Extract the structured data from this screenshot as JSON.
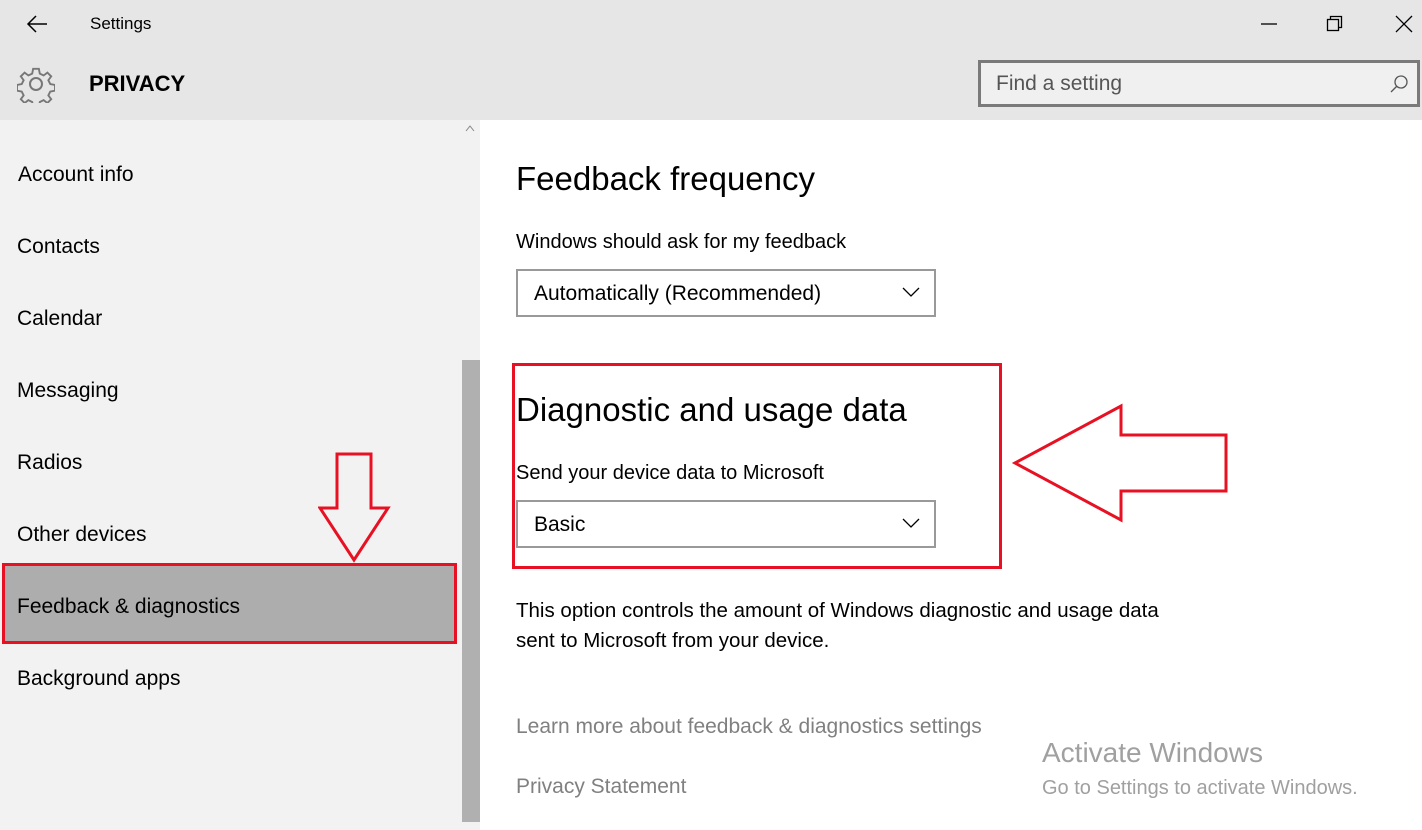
{
  "window": {
    "title": "Settings",
    "minimize": "minimize",
    "restore": "restore",
    "close": "close"
  },
  "header": {
    "section": "PRIVACY",
    "search_placeholder": "Find a setting"
  },
  "sidebar": {
    "items": [
      {
        "label": "Account info"
      },
      {
        "label": "Contacts"
      },
      {
        "label": "Calendar"
      },
      {
        "label": "Messaging"
      },
      {
        "label": "Radios"
      },
      {
        "label": "Other devices"
      },
      {
        "label": "Feedback & diagnostics",
        "selected": true
      },
      {
        "label": "Background apps"
      }
    ]
  },
  "main": {
    "feedback": {
      "heading": "Feedback frequency",
      "label": "Windows should ask for my feedback",
      "value": "Automatically (Recommended)"
    },
    "diagnostic": {
      "heading": "Diagnostic and usage data",
      "label": "Send your device data to Microsoft",
      "value": "Basic"
    },
    "description": "This option controls the amount of Windows diagnostic and usage data sent to Microsoft from your device.",
    "learn_more": "Learn more about feedback & diagnostics settings",
    "privacy": "Privacy Statement"
  },
  "watermark": {
    "title": "Activate Windows",
    "subtitle": "Go to Settings to activate Windows."
  },
  "colors": {
    "annotation": "#e81123",
    "selected": "#adadad",
    "header": "#e6e6e6",
    "sidebar": "#f2f2f2"
  }
}
